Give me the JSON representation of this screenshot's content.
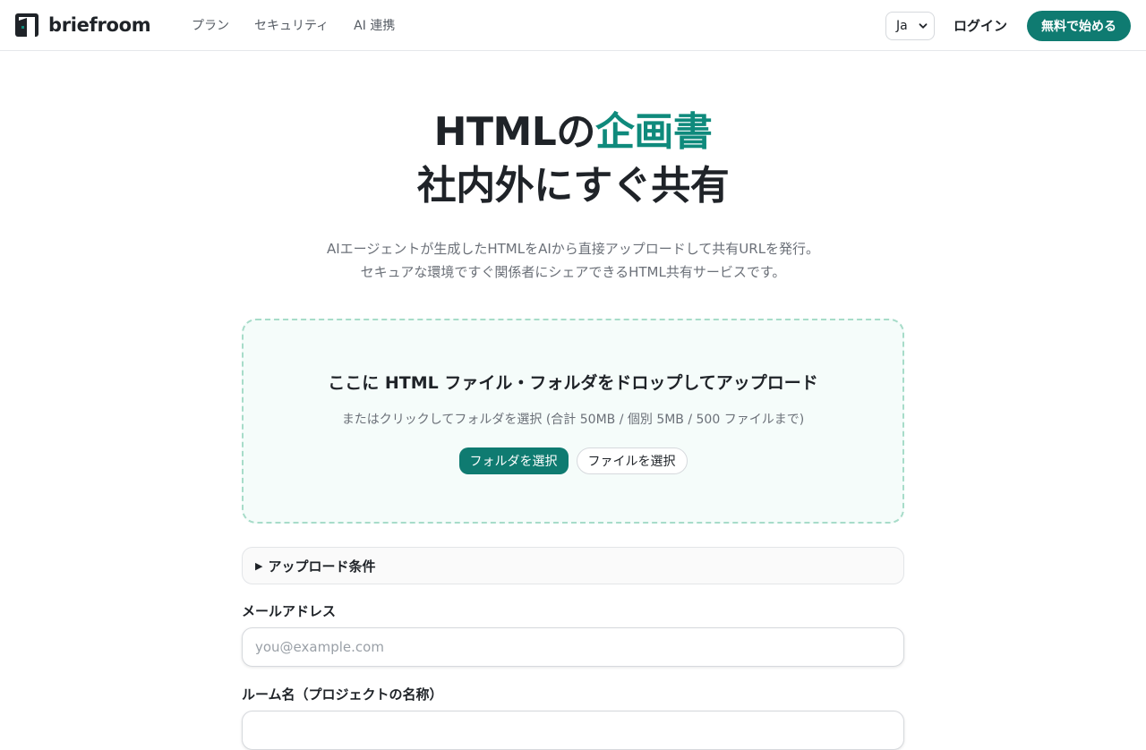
{
  "brand": {
    "name": "briefroom",
    "accent_color": "#0f7b71"
  },
  "nav": {
    "items": [
      "プラン",
      "セキュリティ",
      "AI 連携"
    ]
  },
  "header": {
    "language_selected": "Ja",
    "login_label": "ログイン",
    "cta_label": "無料で始める"
  },
  "hero": {
    "title_line1_prefix": "HTMLの",
    "title_line1_accent": "企画書",
    "title_line2": "社内外にすぐ共有",
    "subtitle_line1": "AIエージェントが生成したHTMLをAIから直接アップロードして共有URLを発行。",
    "subtitle_line2": "セキュアな環境ですぐ関係者にシェアできるHTML共有サービスです。"
  },
  "dropzone": {
    "title": "ここに HTML ファイル・フォルダをドロップしてアップロード",
    "note": "またはクリックしてフォルダを選択 (合計 50MB / 個別 5MB / 500 ファイルまで)",
    "select_folder_label": "フォルダを選択",
    "select_file_label": "ファイルを選択"
  },
  "conditions": {
    "label": "アップロード条件"
  },
  "form": {
    "email_label": "メールアドレス",
    "email_placeholder": "you@example.com",
    "email_value": "",
    "room_label": "ルーム名（プロジェクトの名称）"
  }
}
